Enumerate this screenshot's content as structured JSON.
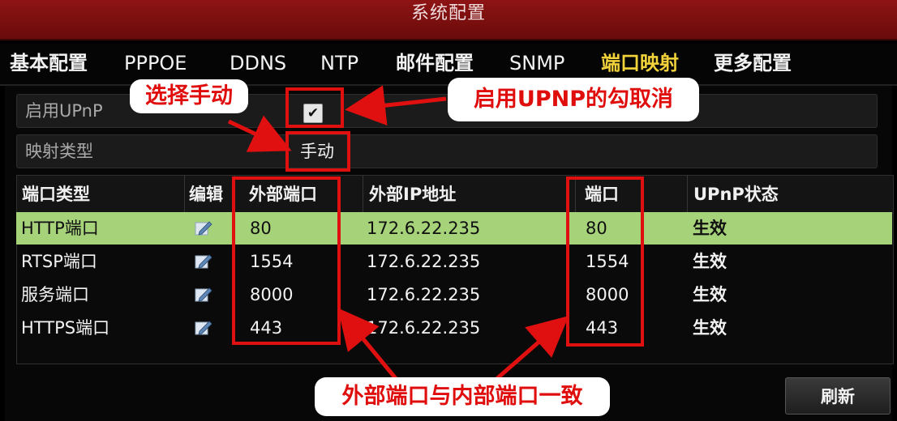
{
  "window": {
    "title": "系统配置"
  },
  "tabs": [
    {
      "label": "基本配置",
      "active": false
    },
    {
      "label": "PPPOE",
      "active": false
    },
    {
      "label": "DDNS",
      "active": false
    },
    {
      "label": "NTP",
      "active": false
    },
    {
      "label": "邮件配置",
      "active": false
    },
    {
      "label": "SNMP",
      "active": false
    },
    {
      "label": "端口映射",
      "active": true
    },
    {
      "label": "更多配置",
      "active": false
    }
  ],
  "settings": {
    "upnp_label": "启用UPnP",
    "upnp_checked": true,
    "checkbox_glyph": "✔",
    "mapping_label": "映射类型",
    "mapping_value": "手动"
  },
  "table": {
    "headers": [
      "端口类型",
      "编辑",
      "外部端口",
      "外部IP地址",
      "端口",
      "UPnP状态"
    ],
    "rows": [
      {
        "type": "HTTP端口",
        "external_port": "80",
        "external_ip": "172.6.22.235",
        "port": "80",
        "status": "生效",
        "selected": true
      },
      {
        "type": "RTSP端口",
        "external_port": "1554",
        "external_ip": "172.6.22.235",
        "port": "1554",
        "status": "生效",
        "selected": false
      },
      {
        "type": "服务端口",
        "external_port": "8000",
        "external_ip": "172.6.22.235",
        "port": "8000",
        "status": "生效",
        "selected": false
      },
      {
        "type": "HTTPS端口",
        "external_port": "443",
        "external_ip": "172.6.22.235",
        "port": "443",
        "status": "生效",
        "selected": false
      }
    ]
  },
  "buttons": {
    "refresh_label": "刷新"
  },
  "annotations": {
    "select_manual": "选择手动",
    "uncheck_upnp": "启用UPNP的勾取消",
    "ports_match": "外部端口与内部端口一致"
  },
  "colors": {
    "title_bar": "#8e1414",
    "active_tab": "#f2d23a",
    "selected_row": "#a6d27a",
    "annotation_red": "#e01010"
  },
  "icons": {
    "edit": "edit-icon",
    "check": "check-icon"
  }
}
